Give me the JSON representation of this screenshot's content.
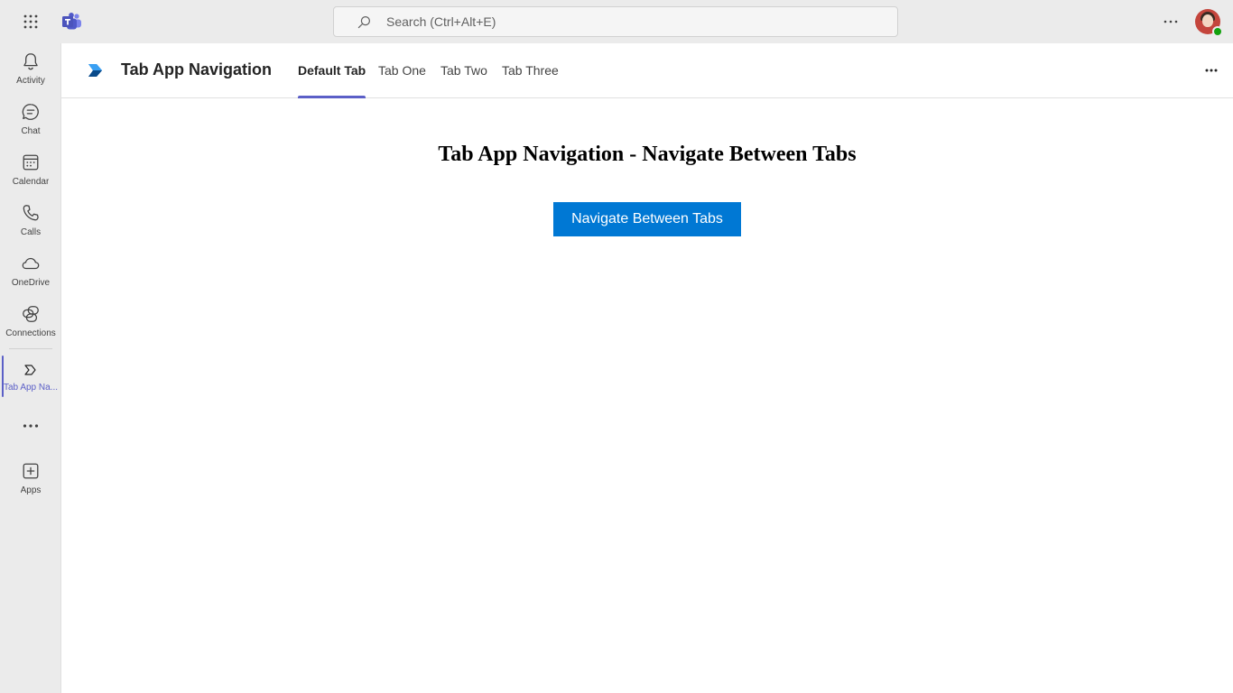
{
  "topbar": {
    "search_placeholder": "Search (Ctrl+Alt+E)"
  },
  "rail": {
    "items": [
      {
        "label": "Activity",
        "icon": "bell-icon"
      },
      {
        "label": "Chat",
        "icon": "chat-icon"
      },
      {
        "label": "Calendar",
        "icon": "calendar-icon"
      },
      {
        "label": "Calls",
        "icon": "phone-icon"
      },
      {
        "label": "OneDrive",
        "icon": "cloud-icon"
      },
      {
        "label": "Connections",
        "icon": "connections-icon"
      },
      {
        "label": "Tab App Na...",
        "icon": "tab-app-icon",
        "active": true
      },
      {
        "label": "Apps",
        "icon": "add-apps-icon"
      }
    ]
  },
  "app": {
    "title": "Tab App Navigation",
    "tabs": [
      {
        "label": "Default Tab",
        "active": true
      },
      {
        "label": "Tab One"
      },
      {
        "label": "Tab Two"
      },
      {
        "label": "Tab Three"
      }
    ]
  },
  "content": {
    "heading": "Tab App Navigation - Navigate Between Tabs",
    "button_label": "Navigate Between Tabs"
  },
  "colors": {
    "accent": "#5b5fc7",
    "button": "#0078d4",
    "status_available": "#13a10e"
  }
}
